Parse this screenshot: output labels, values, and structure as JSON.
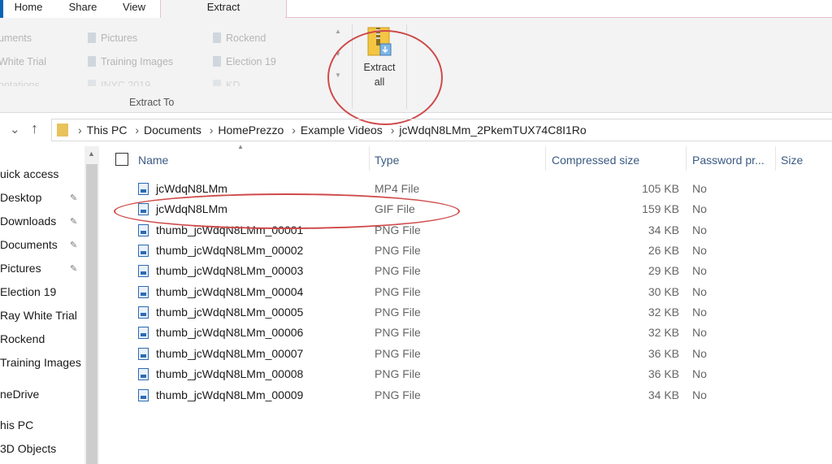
{
  "tabs": [
    "Home",
    "Share",
    "View",
    "Extract"
  ],
  "ribbon": {
    "extract_to_items": [
      [
        "uments",
        "White Trial",
        "ontations"
      ],
      [
        "Pictures",
        "Training Images",
        "INYC 2019"
      ],
      [
        "Rockend",
        "Election 19",
        "KD"
      ]
    ],
    "group_label": "Extract To",
    "extract_all": [
      "Extract",
      "all"
    ]
  },
  "address": {
    "crumbs": [
      "This PC",
      "Documents",
      "HomePrezzo",
      "Example Videos",
      "jcWdqN8LMm_2PkemTUX74C8I1Ro"
    ]
  },
  "nav": {
    "items": [
      "uick access",
      "Desktop",
      "Downloads",
      "Documents",
      "Pictures",
      "Election 19",
      "Ray White Trial",
      "Rockend",
      "Training Images",
      "neDrive",
      "his PC",
      "3D Objects"
    ]
  },
  "columns": {
    "name": "Name",
    "type": "Type",
    "compressed": "Compressed size",
    "password": "Password pr...",
    "size": "Size"
  },
  "files": [
    {
      "name": "jcWdqN8LMm",
      "type": "MP4 File",
      "compressed": "105 KB",
      "password": "No"
    },
    {
      "name": "jcWdqN8LMm",
      "type": "GIF File",
      "compressed": "159 KB",
      "password": "No"
    },
    {
      "name": "thumb_jcWdqN8LMm_00001",
      "type": "PNG File",
      "compressed": "34 KB",
      "password": "No"
    },
    {
      "name": "thumb_jcWdqN8LMm_00002",
      "type": "PNG File",
      "compressed": "26 KB",
      "password": "No"
    },
    {
      "name": "thumb_jcWdqN8LMm_00003",
      "type": "PNG File",
      "compressed": "29 KB",
      "password": "No"
    },
    {
      "name": "thumb_jcWdqN8LMm_00004",
      "type": "PNG File",
      "compressed": "30 KB",
      "password": "No"
    },
    {
      "name": "thumb_jcWdqN8LMm_00005",
      "type": "PNG File",
      "compressed": "32 KB",
      "password": "No"
    },
    {
      "name": "thumb_jcWdqN8LMm_00006",
      "type": "PNG File",
      "compressed": "32 KB",
      "password": "No"
    },
    {
      "name": "thumb_jcWdqN8LMm_00007",
      "type": "PNG File",
      "compressed": "36 KB",
      "password": "No"
    },
    {
      "name": "thumb_jcWdqN8LMm_00008",
      "type": "PNG File",
      "compressed": "36 KB",
      "password": "No"
    },
    {
      "name": "thumb_jcWdqN8LMm_00009",
      "type": "PNG File",
      "compressed": "34 KB",
      "password": "No"
    }
  ],
  "colors": {
    "annotation": "#cf4a4a",
    "accent": "#0b63b6",
    "header_text": "#3a5a83"
  }
}
